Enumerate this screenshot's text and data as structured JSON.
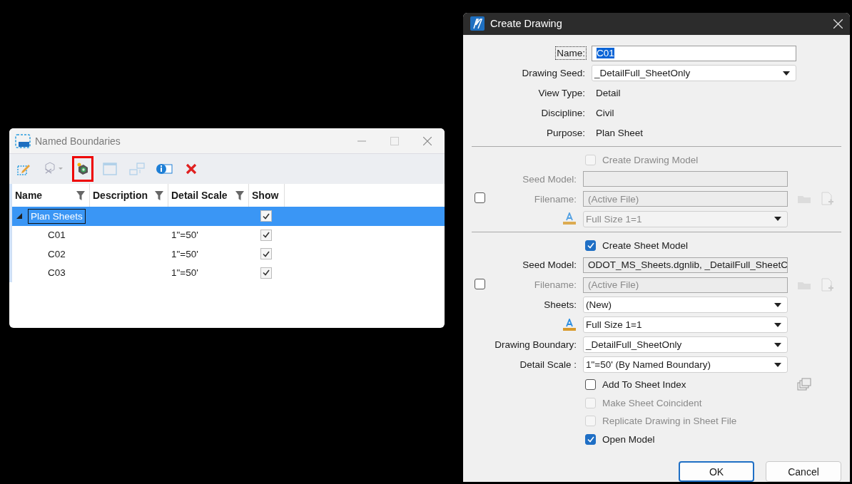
{
  "named_boundaries": {
    "title": "Named Boundaries",
    "toolbar": [
      {
        "kind": "edit",
        "disabled": false,
        "highlighted": false
      },
      {
        "kind": "tool-dropdown",
        "disabled": true,
        "highlighted": false
      },
      {
        "kind": "create-drawing",
        "disabled": false,
        "highlighted": true
      },
      {
        "kind": "fit",
        "disabled": true,
        "highlighted": false
      },
      {
        "kind": "move",
        "disabled": true,
        "highlighted": false
      },
      {
        "kind": "properties",
        "disabled": false,
        "highlighted": false
      },
      {
        "kind": "delete",
        "disabled": false,
        "highlighted": false
      }
    ],
    "columns": [
      {
        "label": "Name",
        "filter": true
      },
      {
        "label": "Description",
        "filter": true
      },
      {
        "label": "Detail Scale",
        "filter": true
      },
      {
        "label": "Show",
        "filter": false
      }
    ],
    "rows": [
      {
        "name": "Plan Sheets",
        "detail_scale": "",
        "show": true,
        "selected": true,
        "expanded": true,
        "children": [
          {
            "name": "C01",
            "detail_scale": "1\"=50'",
            "show": true,
            "selected": false
          },
          {
            "name": "C02",
            "detail_scale": "1\"=50'",
            "show": true,
            "selected": false
          },
          {
            "name": "C03",
            "detail_scale": "1\"=50'",
            "show": true,
            "selected": false
          }
        ]
      }
    ]
  },
  "create_drawing": {
    "title": "Create Drawing",
    "sections": [
      {
        "rows": [
          {
            "kind": "input",
            "label": "Name:",
            "value": "C01",
            "disabled": false,
            "focused": true,
            "value_selected": true
          },
          {
            "kind": "select",
            "label": "Drawing Seed:",
            "value": "_DetailFull_SheetOnly",
            "disabled": false
          },
          {
            "kind": "static",
            "label": "View Type:",
            "value": "Detail"
          },
          {
            "kind": "static",
            "label": "Discipline:",
            "value": "Civil"
          },
          {
            "kind": "static",
            "label": "Purpose:",
            "value": "Plan Sheet"
          }
        ]
      },
      {
        "side_checked": false,
        "rows": [
          {
            "kind": "checkbox",
            "label": "Create Drawing Model",
            "checked": false,
            "disabled": true
          },
          {
            "kind": "input",
            "label": "Seed Model:",
            "disabled": true
          },
          {
            "kind": "file",
            "label": "Filename:",
            "value": "(Active File)",
            "disabled": true
          },
          {
            "kind": "annotation",
            "value": "Full Size 1=1",
            "disabled": true
          }
        ]
      },
      {
        "side_checked": false,
        "rows": [
          {
            "kind": "checkbox",
            "label": "Create Sheet Model",
            "checked": true,
            "disabled": false
          },
          {
            "kind": "input",
            "label": "Seed Model:",
            "value": "ODOT_MS_Sheets.dgnlib, _DetailFull_SheetC",
            "disabled": false,
            "readonly": true
          },
          {
            "kind": "file",
            "label": "Filename:",
            "value": "(Active File)",
            "disabled": true
          },
          {
            "kind": "select",
            "label": "Sheets:",
            "value": "(New)",
            "disabled": false
          },
          {
            "kind": "annotation",
            "value": "Full Size 1=1",
            "disabled": false
          },
          {
            "kind": "select",
            "label": "Drawing Boundary:",
            "value": "_DetailFull_SheetOnly",
            "disabled": false
          },
          {
            "kind": "select",
            "label": "Detail Scale :",
            "value": "1\"=50' (By Named Boundary)",
            "disabled": false
          },
          {
            "kind": "checkbox",
            "label": "Add To Sheet Index",
            "checked": false,
            "disabled": false,
            "tool": true
          },
          {
            "kind": "checkbox",
            "label": "Make Sheet Coincident",
            "checked": false,
            "disabled": true
          },
          {
            "kind": "checkbox",
            "label": "Replicate Drawing in Sheet File",
            "checked": false,
            "disabled": true
          },
          {
            "kind": "checkbox",
            "label": "Open Model",
            "checked": true,
            "disabled": false
          }
        ]
      }
    ],
    "buttons": [
      {
        "label": "OK",
        "default": true
      },
      {
        "label": "Cancel",
        "default": false
      }
    ]
  }
}
